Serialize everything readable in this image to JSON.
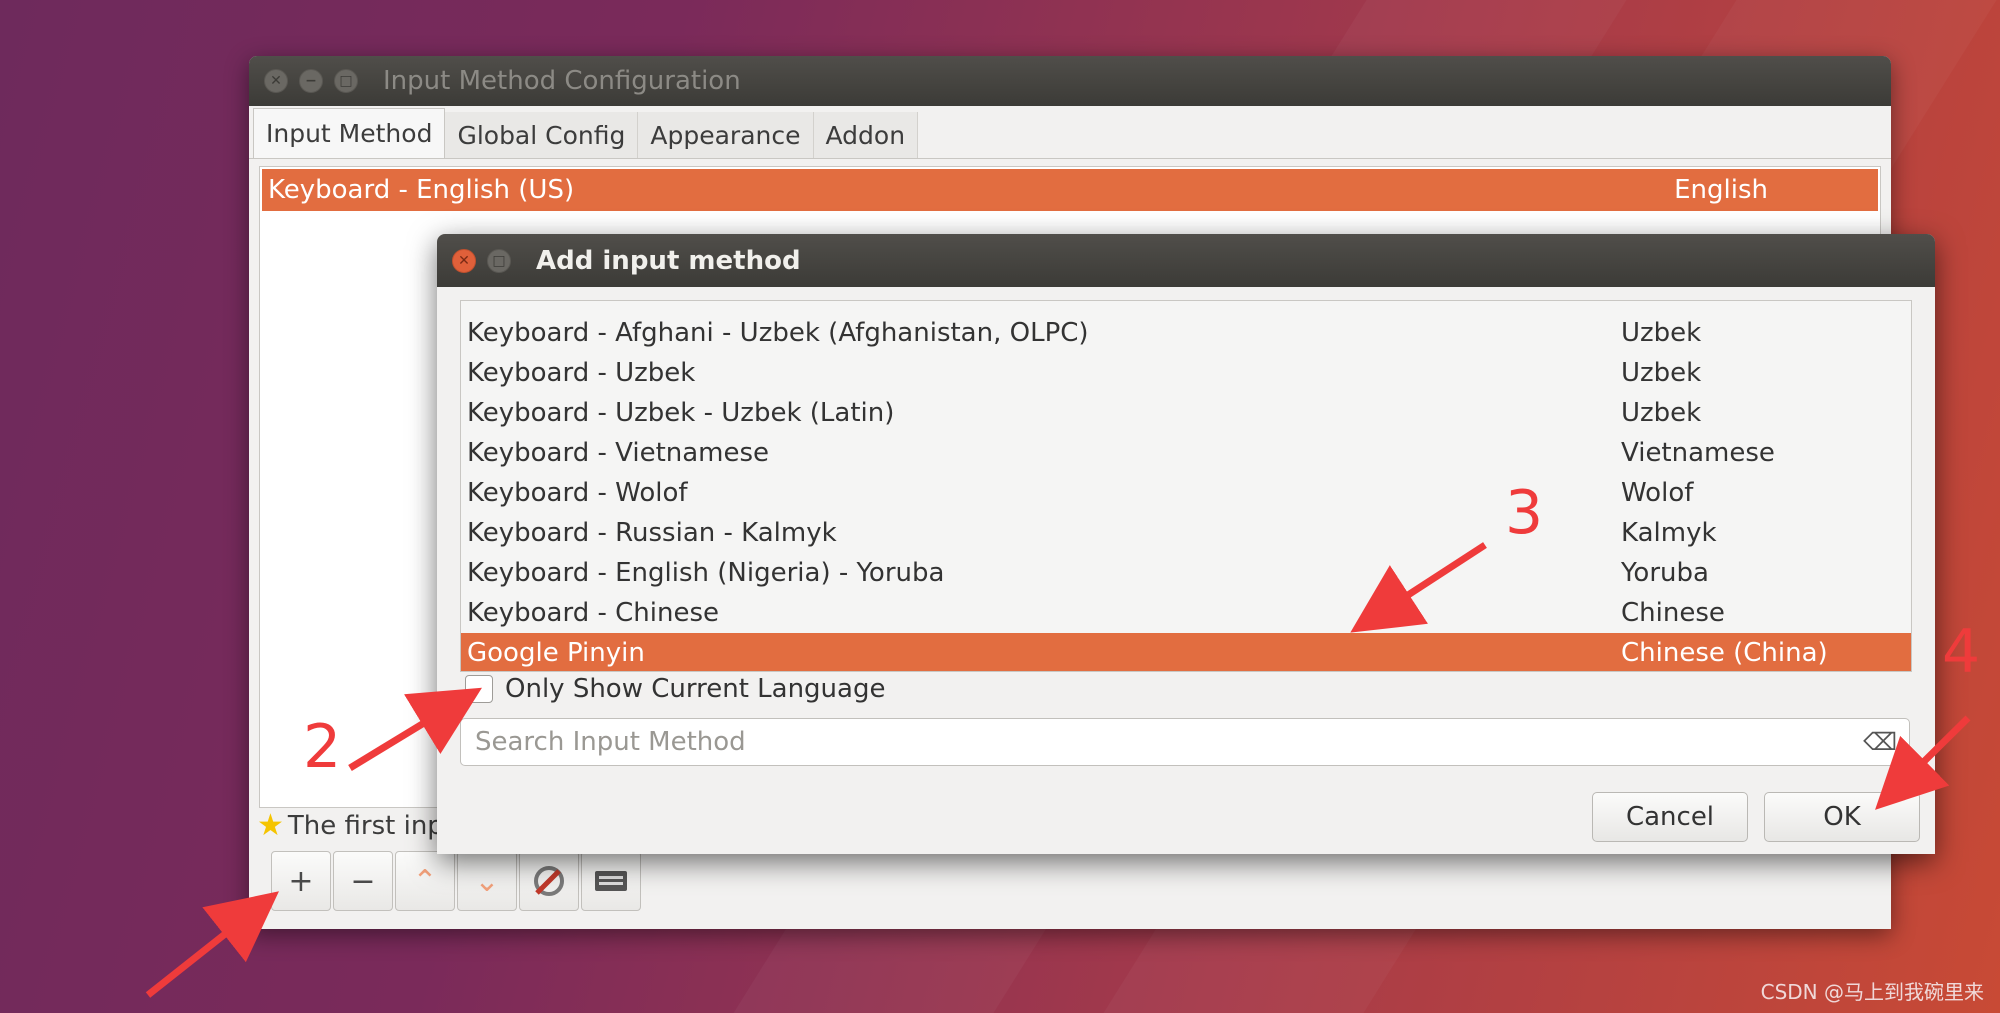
{
  "main_window": {
    "title": "Input Method Configuration",
    "tabs": [
      {
        "label": "Input Method"
      },
      {
        "label": "Global Config"
      },
      {
        "label": "Appearance"
      },
      {
        "label": "Addon"
      }
    ],
    "list": [
      {
        "name": "Keyboard - English (US)",
        "language": "English"
      }
    ],
    "info_text": "The first inp",
    "toolbar": {
      "add": "+",
      "remove": "−",
      "up": "⌃",
      "down": "⌄"
    }
  },
  "dialog": {
    "title": "Add input method",
    "items": [
      {
        "name": "Keyboard - Afghani - Uzbek (Afghanistan, OLPC)",
        "language": "Uzbek"
      },
      {
        "name": "Keyboard - Uzbek",
        "language": "Uzbek"
      },
      {
        "name": "Keyboard - Uzbek - Uzbek (Latin)",
        "language": "Uzbek"
      },
      {
        "name": "Keyboard - Vietnamese",
        "language": "Vietnamese"
      },
      {
        "name": "Keyboard - Wolof",
        "language": "Wolof"
      },
      {
        "name": "Keyboard - Russian - Kalmyk",
        "language": "Kalmyk"
      },
      {
        "name": "Keyboard - English (Nigeria) - Yoruba",
        "language": "Yoruba"
      },
      {
        "name": "Keyboard - Chinese",
        "language": "Chinese"
      },
      {
        "name": "Google Pinyin",
        "language": "Chinese (China)"
      }
    ],
    "only_show_current_language": "Only Show Current Language",
    "search_placeholder": "Search Input Method",
    "cancel": "Cancel",
    "ok": "OK"
  },
  "annotations": [
    "2",
    "3",
    "4"
  ],
  "watermark": "CSDN @马上到我碗里来",
  "colors": {
    "selection": "#e26d40",
    "annotation": "#ef3b3b"
  }
}
